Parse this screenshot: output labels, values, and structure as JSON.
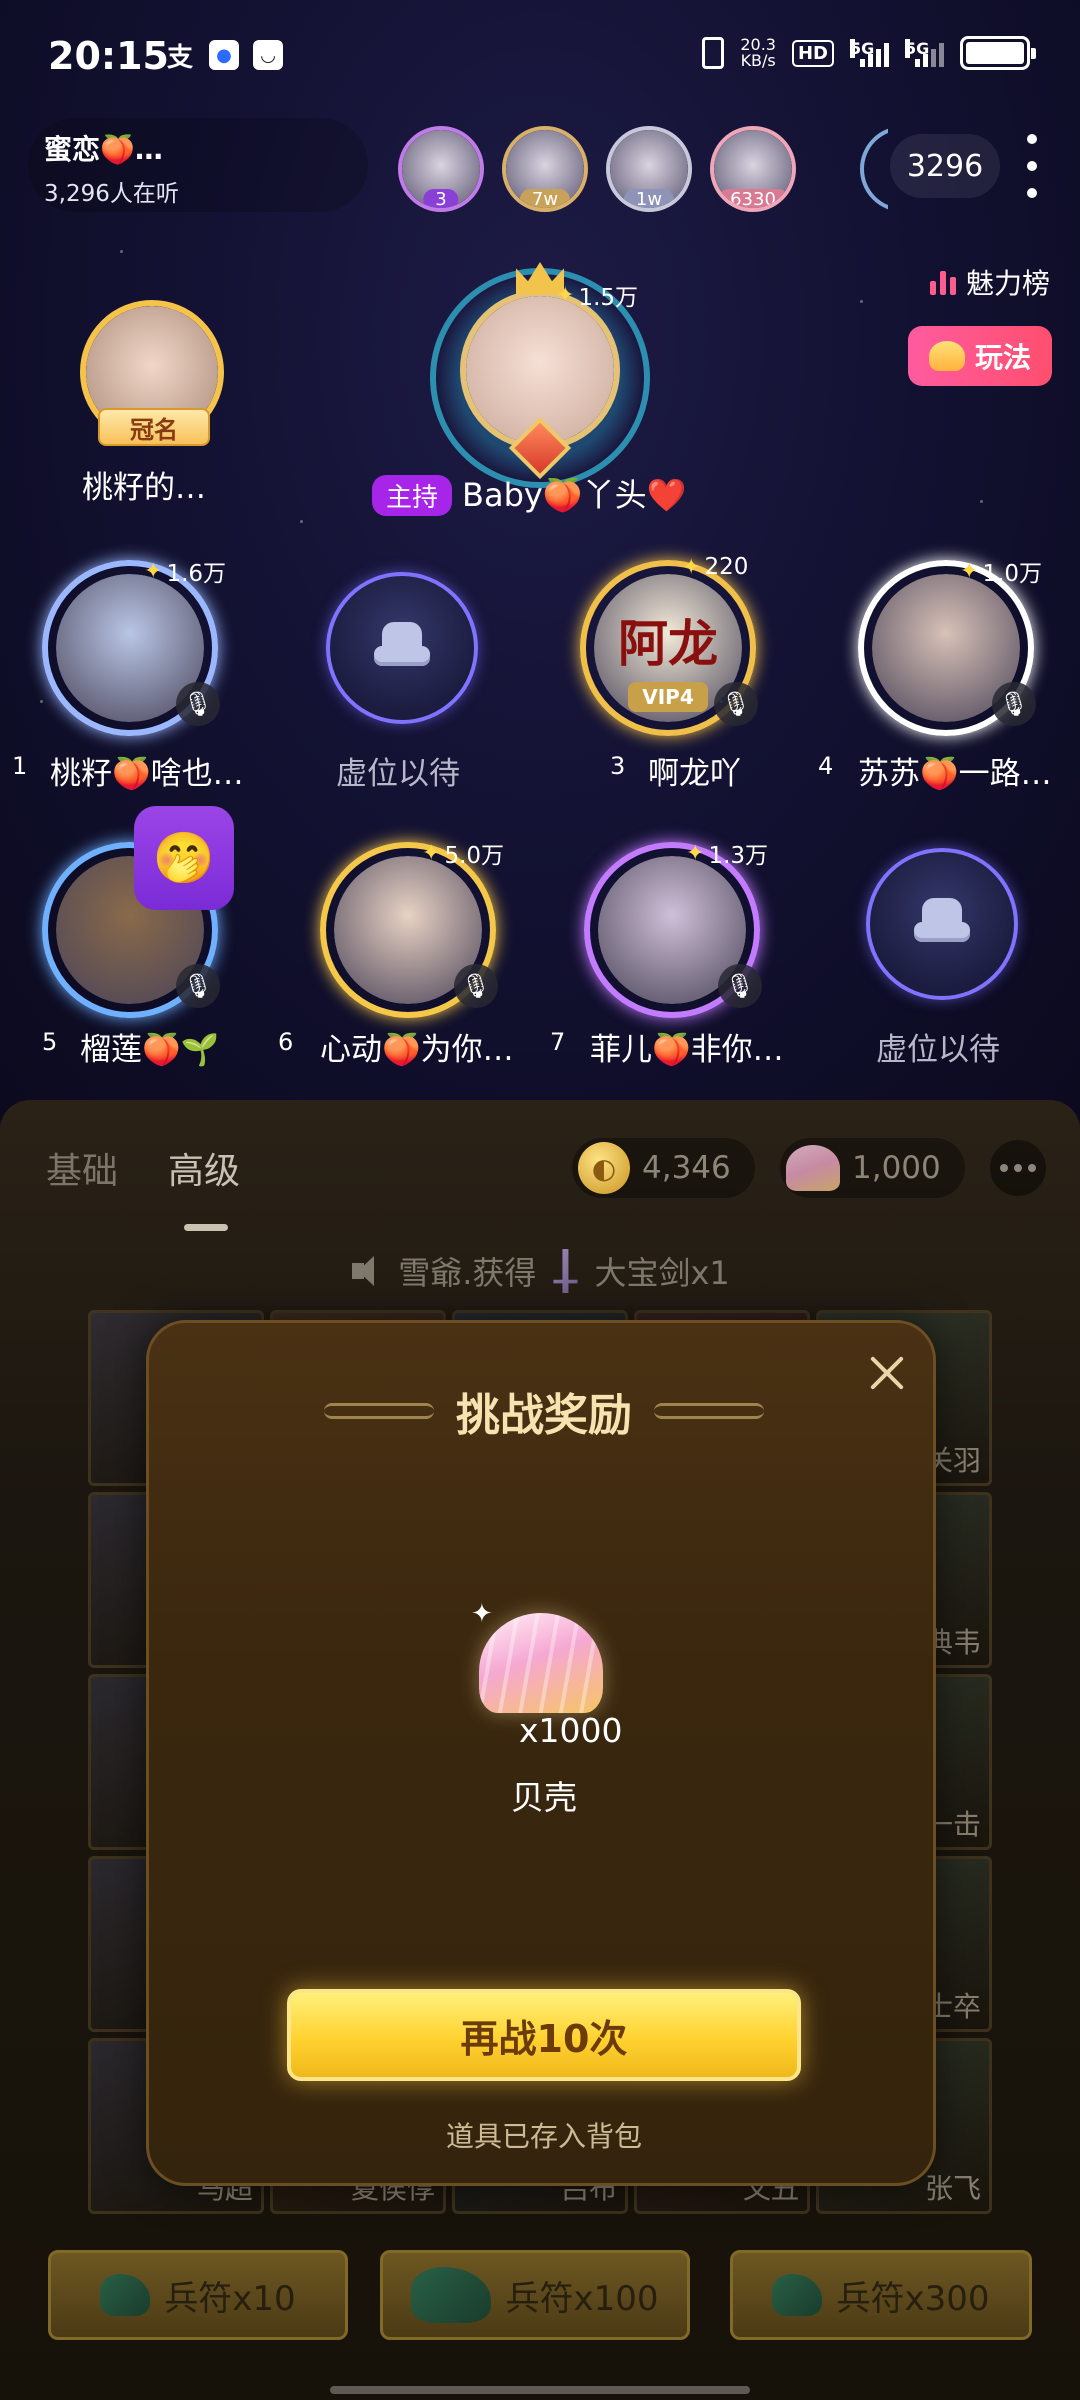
{
  "status_bar": {
    "time": "20:15",
    "net_speed_value": "20.3",
    "net_speed_unit": "KB/s",
    "hd_label": "HD",
    "signal1_label": "5G",
    "signal2_label": "5G",
    "battery_level": 1.0,
    "app_icons": [
      "alipay-icon",
      "baidu-icon",
      "message-icon"
    ]
  },
  "room": {
    "name": "蜜恋🍑…",
    "listeners": "3,296人在听",
    "online_count": "3296",
    "top_avatars": [
      {
        "badge": "3",
        "frame_color": "#c07be8",
        "badge_color": "#8a3fd6"
      },
      {
        "badge": "7w",
        "frame_color": "#d9b06a",
        "badge_color": "#c9a25a"
      },
      {
        "badge": "1w",
        "frame_color": "#c7c9da",
        "badge_color": "#8f93b8"
      },
      {
        "badge": "6330",
        "frame_color": "#f0a6b8",
        "badge_color": "#d97a95"
      }
    ],
    "charm_label": "魅力榜",
    "play_label": "玩法"
  },
  "host": {
    "tag": "主持",
    "name": "Baby🍑丫头❤️",
    "score": "1.5万"
  },
  "crown_seat": {
    "tag": "冠名",
    "name": "桃籽的…"
  },
  "seats": [
    {
      "num": "1",
      "name": "桃籽🍑啥也…",
      "score": "1.6万",
      "muted": true,
      "frame": "#9bb8ff",
      "face": "#b9c6e6"
    },
    {
      "num": "",
      "name": "虚位以待",
      "empty": true
    },
    {
      "num": "3",
      "name": "啊龙吖",
      "score": "220",
      "muted": true,
      "frame": "#f0c04a",
      "face": "#f2ead8",
      "badge_text": "阿龙",
      "vip": "VIP4"
    },
    {
      "num": "4",
      "name": "苏苏🍑一路…",
      "score": "1.0万",
      "muted": true,
      "frame": "#ffffff",
      "face": "#d8c2b8"
    },
    {
      "num": "5",
      "name": "榴莲🍑🌱",
      "score": "",
      "muted": true,
      "frame": "#6fb0ff",
      "face": "#8a6a4a",
      "emoji": "🤭"
    },
    {
      "num": "6",
      "name": "心动🍑为你…",
      "score": "5.0万",
      "muted": true,
      "frame": "#f5c84a",
      "face": "#e8d2c4"
    },
    {
      "num": "7",
      "name": "菲儿🍑非你…",
      "score": "1.3万",
      "muted": true,
      "frame": "#c37bff",
      "face": "#cfc0d8"
    },
    {
      "num": "",
      "name": "虚位以待",
      "empty": true
    }
  ],
  "panel": {
    "tab_basic": "基础",
    "tab_advanced": "高级",
    "active_tab": "高级",
    "coins": "4,346",
    "shells": "1,000",
    "notice_user": "雪爺.获得",
    "notice_item": "大宝剑x1",
    "grid_labels": [
      "关羽",
      "典韦",
      "一击",
      "士卒",
      "张飞",
      "马超",
      "夏侯惇",
      "吕布",
      "文丑"
    ],
    "bottom_buttons": [
      "兵符x10",
      "兵符x100",
      "兵符x300"
    ]
  },
  "modal": {
    "title": "挑战奖励",
    "reward_qty": "x1000",
    "reward_name": "贝壳",
    "retry_label": "再战10次",
    "stored_note": "道具已存入背包"
  }
}
